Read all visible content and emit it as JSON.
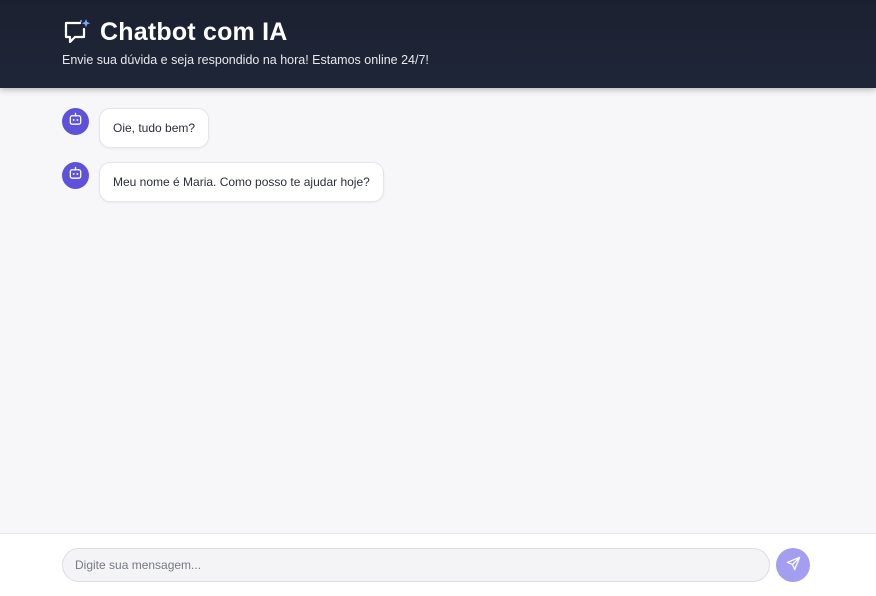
{
  "header": {
    "title": "Chatbot com IA",
    "subtitle": "Envie sua dúvida e seja respondido na hora! Estamos online 24/7!",
    "icon": "chat-sparkle-icon"
  },
  "messages": [
    {
      "sender": "bot",
      "avatar_icon": "bot-icon",
      "text": "Oie, tudo bem?"
    },
    {
      "sender": "bot",
      "avatar_icon": "bot-icon",
      "text": "Meu nome é Maria. Como posso te ajudar hoje?"
    }
  ],
  "composer": {
    "placeholder": "Digite sua mensagem...",
    "value": "",
    "send_icon": "send-icon"
  },
  "colors": {
    "header_bg": "#1b2131",
    "accent": "#5d52d9",
    "send_button": "#a49ef0",
    "page_bg": "#f7f7f9"
  }
}
